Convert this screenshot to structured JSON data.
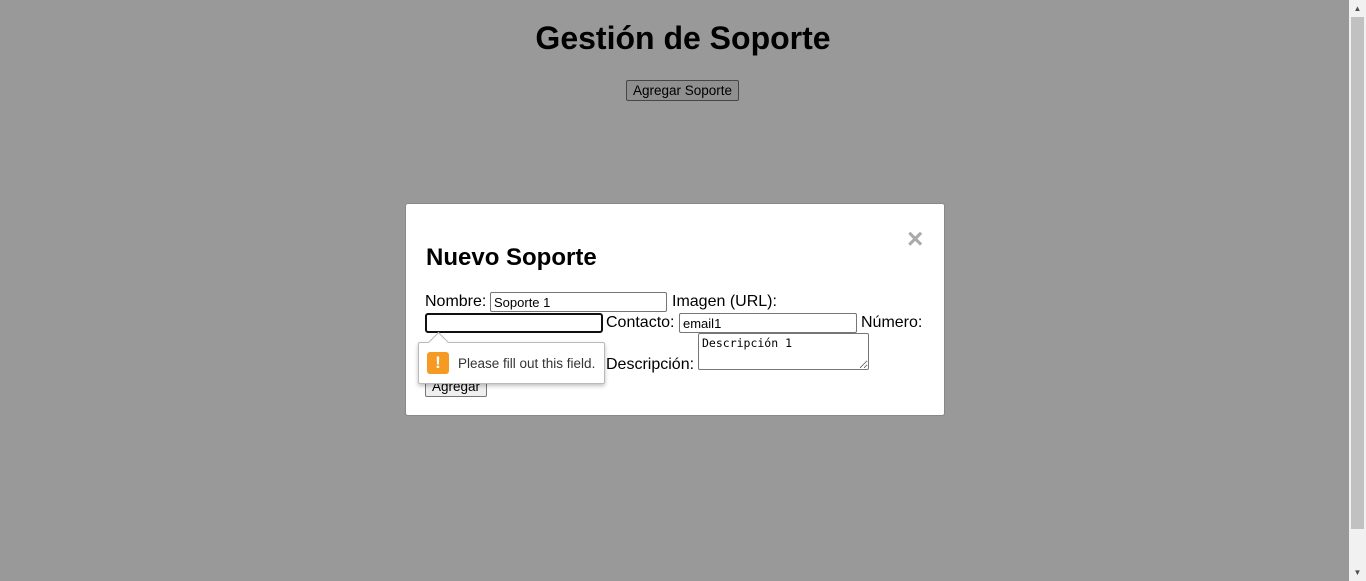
{
  "page": {
    "title": "Gestión de Soporte",
    "add_button": "Agregar Soporte"
  },
  "modal": {
    "title": "Nuevo Soporte",
    "close_symbol": "×",
    "fields": {
      "nombre": {
        "label": "Nombre:",
        "value": "Soporte 1"
      },
      "imagen": {
        "label": "Imagen (URL):",
        "value": ""
      },
      "contacto": {
        "label": "Contacto:",
        "value": "email1"
      },
      "numero": {
        "label": "Número:"
      },
      "descripcion": {
        "label": "Descripción:",
        "value": "Descripción 1"
      }
    },
    "submit_button": "Agregar"
  },
  "validation_tooltip": {
    "icon": "warning-icon",
    "icon_symbol": "!",
    "message": "Please fill out this field.",
    "icon_color": "#f59a23"
  },
  "colors": {
    "overlay": "rgba(0,0,0,0.4)",
    "close": "#aaaaaa"
  }
}
